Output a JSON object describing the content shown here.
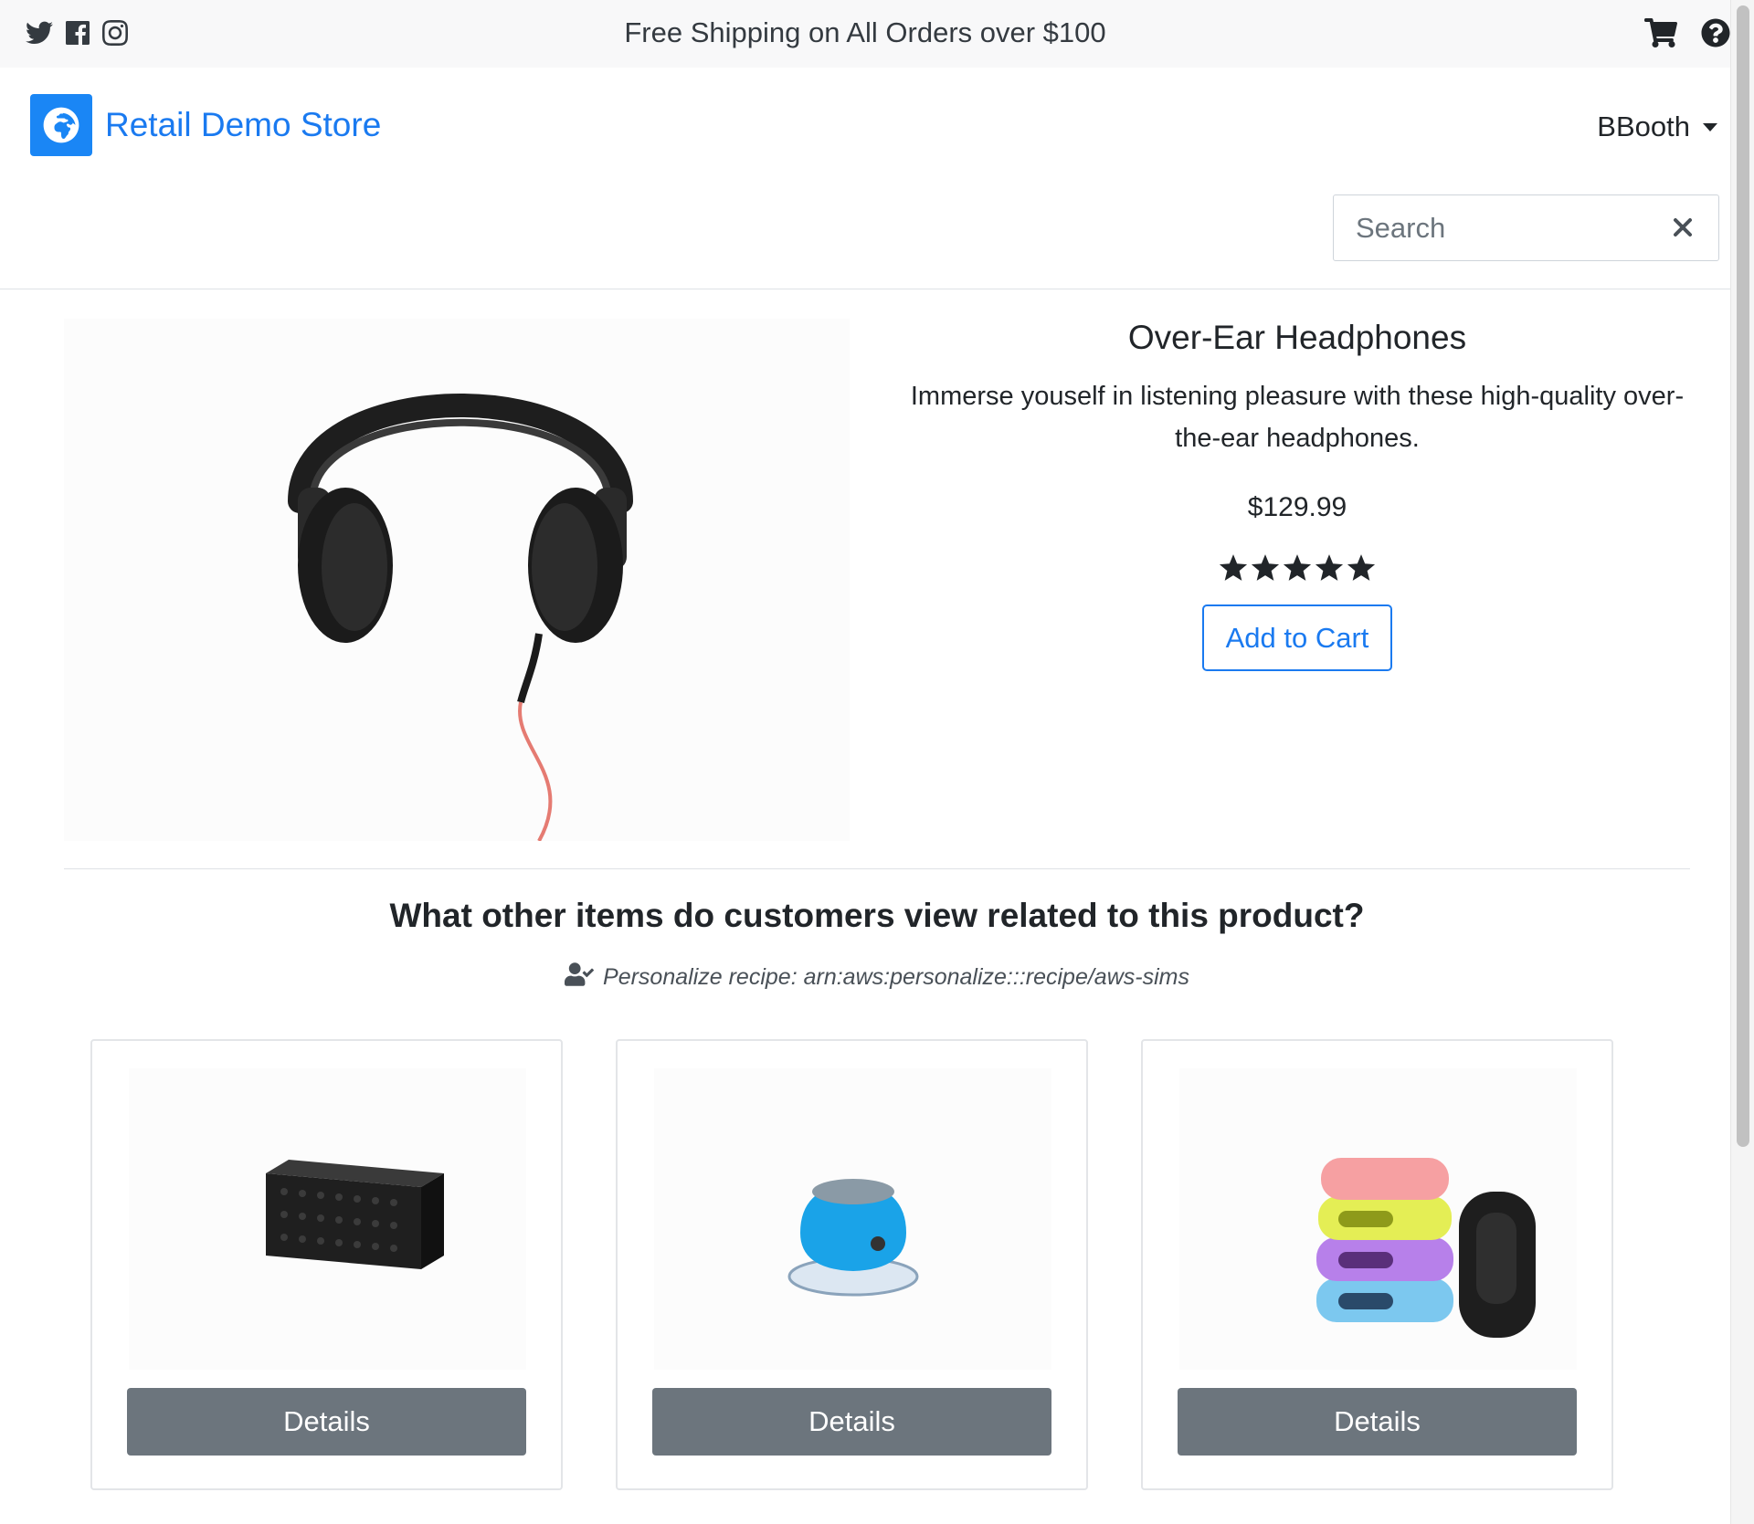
{
  "topbar": {
    "promo_text": "Free Shipping on All Orders over $100",
    "social_icons": [
      "twitter-icon",
      "facebook-icon",
      "instagram-icon"
    ],
    "right_icons": [
      "cart-icon",
      "help-icon"
    ]
  },
  "header": {
    "brand_name": "Retail Demo Store",
    "user_name": "BBooth",
    "search_placeholder": "Search"
  },
  "product": {
    "name": "Over-Ear Headphones",
    "description": "Immerse youself in listening pleasure with these high-quality over-the-ear headphones.",
    "price": "$129.99",
    "rating": 5,
    "add_to_cart_label": "Add to Cart"
  },
  "related": {
    "title": "What other items do customers view related to this product?",
    "recipe_text": "Personalize recipe: arn:aws:personalize:::recipe/aws-sims",
    "items": [
      {
        "image": "black-speaker",
        "details_label": "Details"
      },
      {
        "image": "blue-shower-speaker",
        "details_label": "Details"
      },
      {
        "image": "fitness-band-with-straps",
        "details_label": "Details"
      }
    ]
  },
  "colors": {
    "brand_blue": "#1a7af0",
    "details_button": "#6c757d",
    "topbar_bg": "#f8f8f9"
  }
}
